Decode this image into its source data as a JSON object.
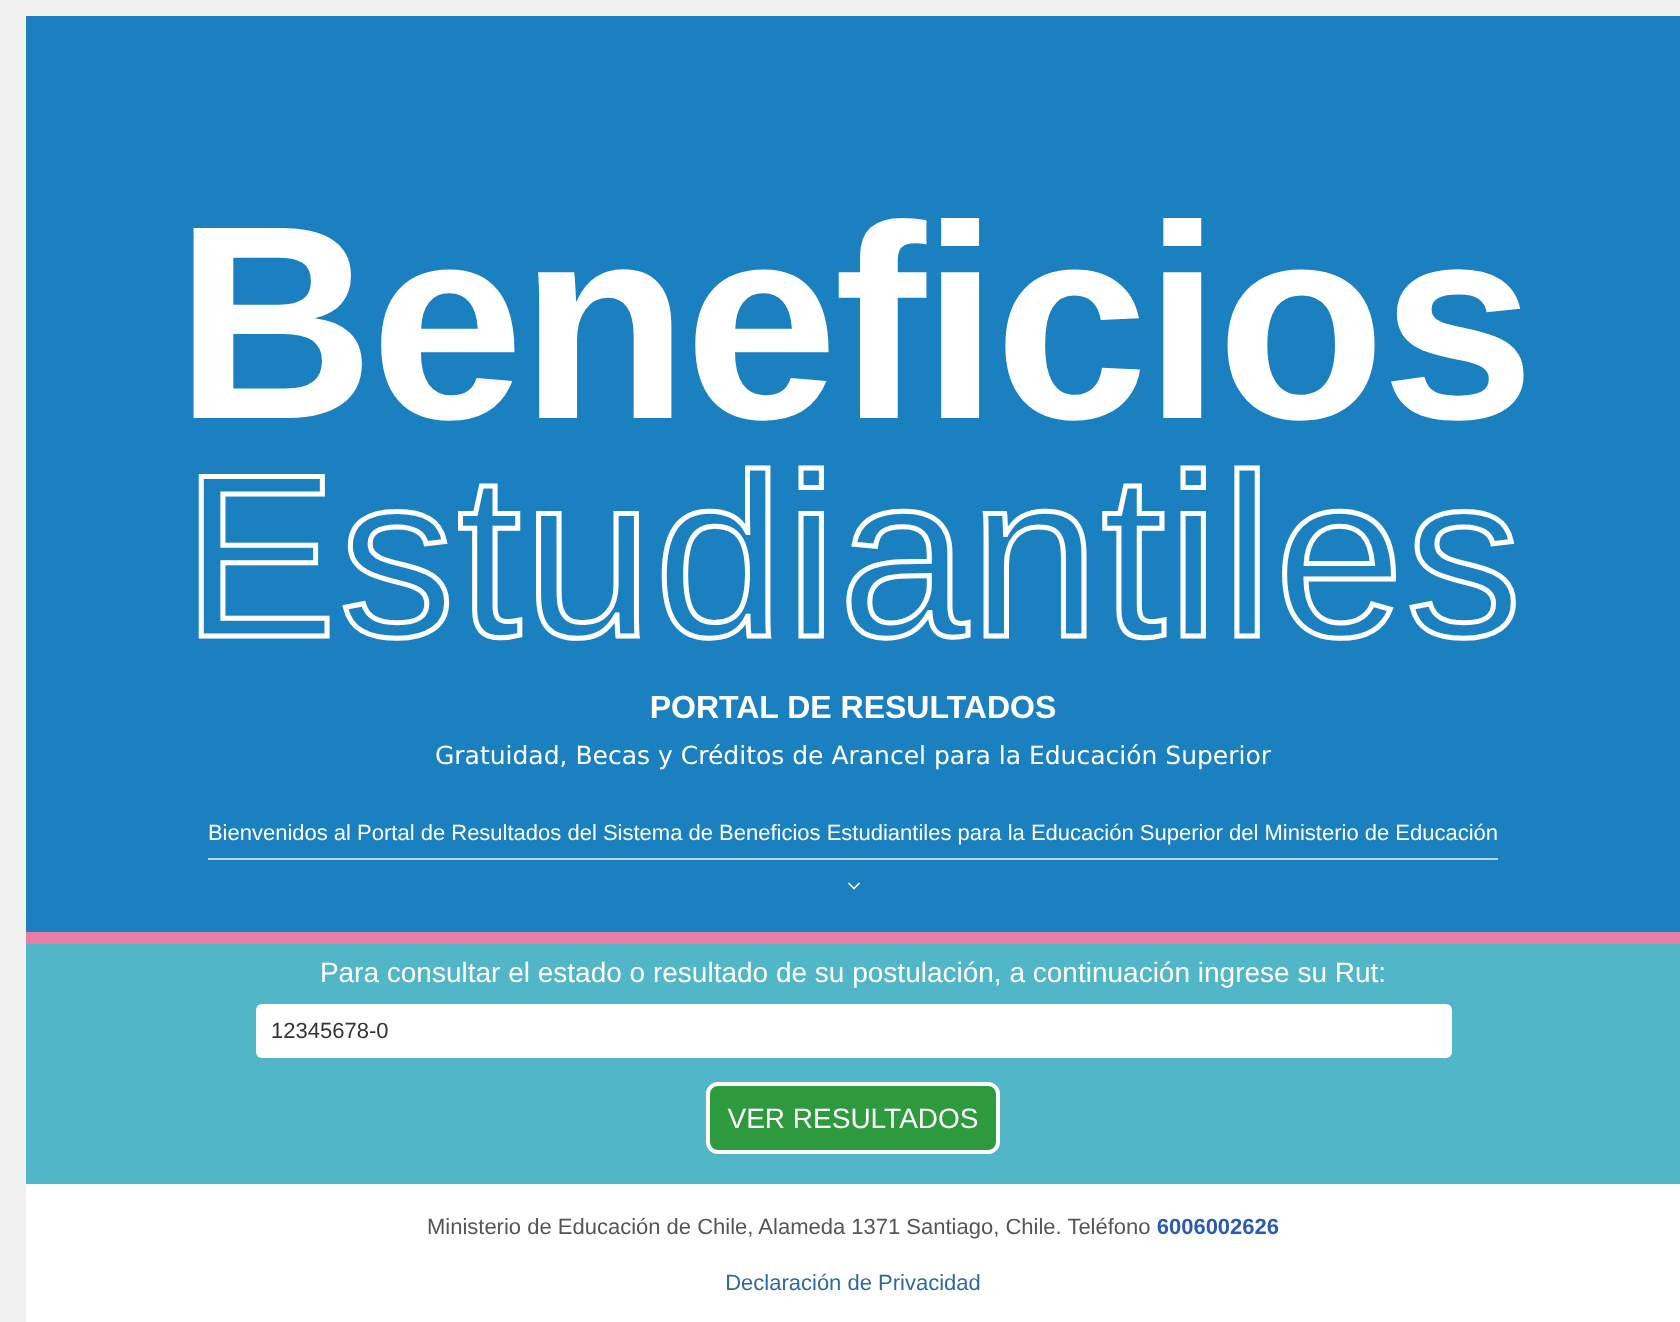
{
  "hero": {
    "title": "Beneficios",
    "subtitle": "Estudiantiles",
    "portal_title": "PORTAL DE RESULTADOS",
    "tagline": "Gratuidad, Becas y Créditos de Arancel para la Educación Superior",
    "welcome": "Bienvenidos al Portal de Resultados del Sistema de Beneficios Estudiantiles para la Educación Superior del Ministerio de Educación"
  },
  "form": {
    "prompt": "Para consultar el estado o resultado de su postulación, a continuación ingrese su Rut:",
    "rut_value": "12345678-0",
    "button": "VER RESULTADOS"
  },
  "footer": {
    "address": "Ministerio de Educación de Chile, Alameda 1371 Santiago, Chile. Teléfono",
    "phone": "6006002626",
    "privacy_link": "Declaración de Privacidad"
  }
}
